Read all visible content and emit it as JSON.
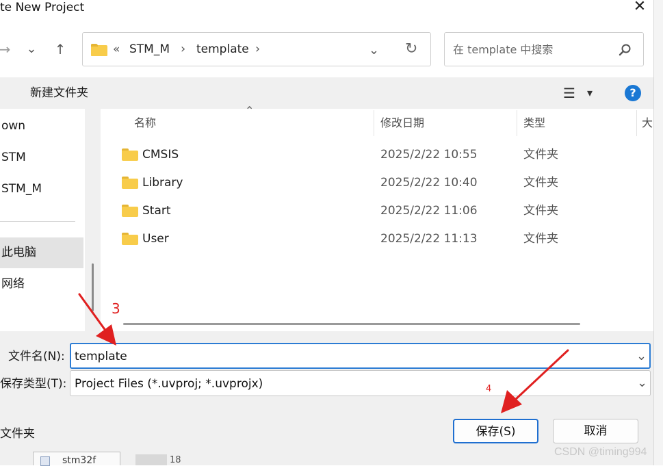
{
  "dialog": {
    "title": "te New Project",
    "close_glyph": "✕"
  },
  "nav": {
    "back_glyph": "→",
    "recent_glyph": "⌄",
    "up_glyph": "↑",
    "breadcrumb": [
      "STM_M",
      "template"
    ],
    "overflow_glyph": "«",
    "separator_glyph": "›",
    "dropdown_glyph": "⌄",
    "refresh_glyph": "↻",
    "search_placeholder": "在 template 中搜索"
  },
  "toolbar": {
    "new_folder_label": "新建文件夹",
    "view_glyph": "☰",
    "view_dropdown_glyph": "▾",
    "help_glyph": "?"
  },
  "left_pane": {
    "items": [
      {
        "label": "own",
        "selected": false
      },
      {
        "label": "STM",
        "selected": false
      },
      {
        "label": "STM_M",
        "selected": false
      },
      {
        "label": "此电脑",
        "selected": true
      },
      {
        "label": "网络",
        "selected": false
      }
    ]
  },
  "file_list": {
    "columns": {
      "name": "名称",
      "date": "修改日期",
      "type": "类型",
      "size": "大"
    },
    "sort_glyph": "⌃",
    "rows": [
      {
        "name": "CMSIS",
        "date": "2025/2/22 10:55",
        "type": "文件夹"
      },
      {
        "name": "Library",
        "date": "2025/2/22 10:40",
        "type": "文件夹"
      },
      {
        "name": "Start",
        "date": "2025/2/22 11:06",
        "type": "文件夹"
      },
      {
        "name": "User",
        "date": "2025/2/22 11:13",
        "type": "文件夹"
      }
    ]
  },
  "form": {
    "filename_label": "文件名(N):",
    "filename_value": "template",
    "filetype_label": "保存类型(T):",
    "filetype_value": "Project Files (*.uvproj; *.uvprojx)",
    "chevron_glyph": "⌄"
  },
  "bottom": {
    "hide_folders_label": "文件夹",
    "save_label": "保存(S)",
    "cancel_label": "取消"
  },
  "annotations": {
    "step3": "3",
    "step4": "4",
    "arrow_color": "#e02020"
  },
  "background": {
    "stub_text": "stm32f",
    "stub_text2": "18"
  },
  "watermark": "CSDN @timing994",
  "colors": {
    "accent": "#1f6fd0",
    "folder": "#f8cc4a",
    "help": "#1a78d4"
  }
}
